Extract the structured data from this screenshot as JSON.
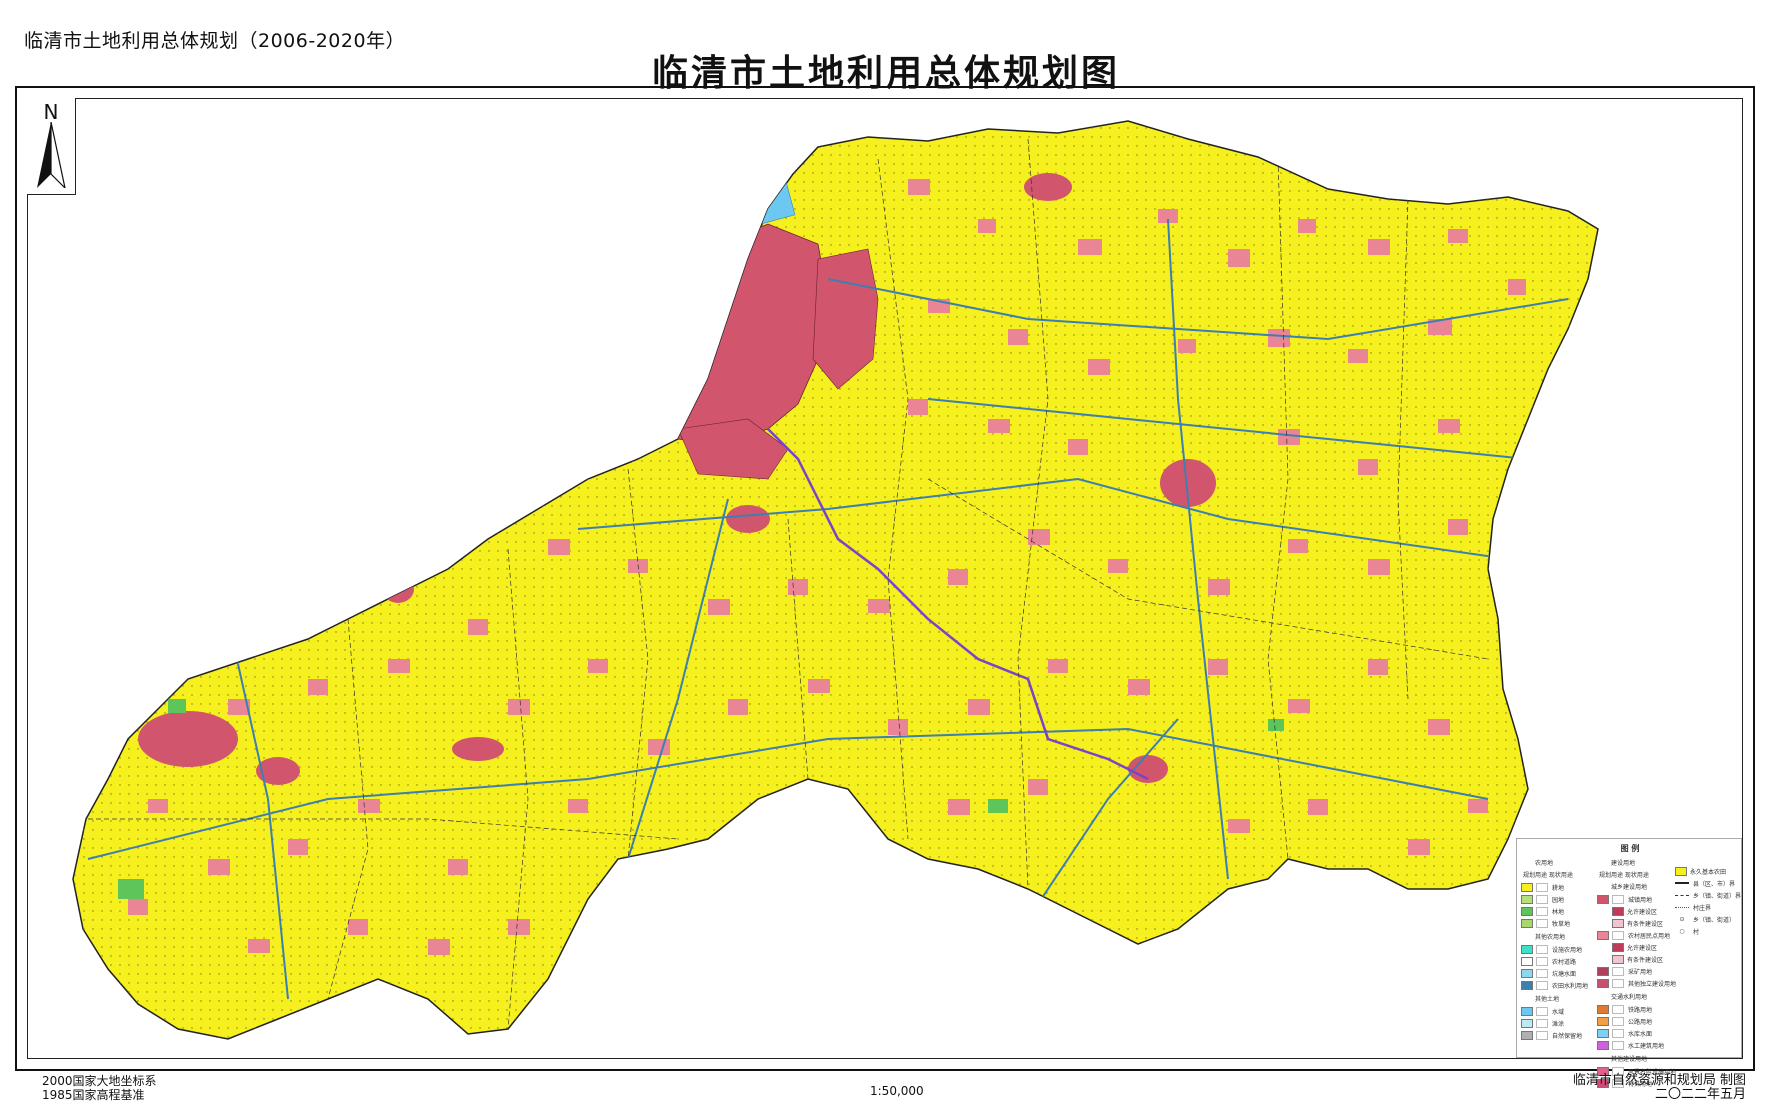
{
  "header": {
    "subtitle": "临清市土地利用总体规划（2006-2020年）",
    "title": "临清市土地利用总体规划图"
  },
  "north_arrow": {
    "label": "N",
    "icon": "north-arrow-icon"
  },
  "colors": {
    "farmland": "#f5f01e",
    "urban": "#d2556e",
    "village": "#ea8596",
    "water": "#6cc8f0",
    "forest": "#5ec55a",
    "road": "#3d7fae",
    "river": "#7a43c8",
    "boundary": "#222222"
  },
  "legend": {
    "title": "图    例",
    "agri_header": "农用地",
    "col_header": "规划用途 现状用途",
    "agri_items": [
      "耕地",
      "园地",
      "林地",
      "牧草地"
    ],
    "other_agri_header": "其他农用地",
    "other_agri_items": [
      "设施农用地",
      "农村道路",
      "坑塘水面",
      "农田水利用地"
    ],
    "other_land_header": "其他土地",
    "other_land_items": [
      "水域",
      "滩涂",
      "自然保留地"
    ],
    "build_header": "建设用地",
    "urban_rural_header": "城乡建设用地",
    "urban_items": [
      "城镇用地",
      "允许建设区",
      "有条件建设区",
      "农村居民点用地",
      "允许建设区",
      "有条件建设区",
      "采矿用地",
      "其他独立建设用地"
    ],
    "transport_header": "交通水利用地",
    "transport_items": [
      "铁路用地",
      "公路用地",
      "水库水面",
      "水工建筑用地"
    ],
    "other_build_header": "其他建设用地",
    "other_build_items": [
      "风景名胜设施用地",
      "特殊用地"
    ],
    "boundary_items": [
      "永久基本农田",
      "县（区、市）界",
      "乡（镇、街道）界",
      "村庄界",
      "乡（镇、街道）",
      "村"
    ]
  },
  "footer": {
    "coord_system": "2000国家大地坐标系",
    "elevation": "1985国家高程基准",
    "scale": "1:50,000",
    "producer": "临清市自然资源和规划局 制图",
    "date": "二〇二二年五月"
  }
}
